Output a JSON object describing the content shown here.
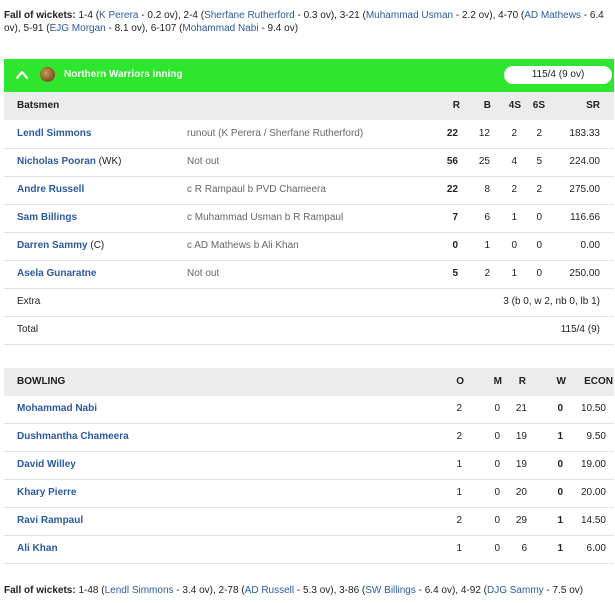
{
  "fall_top": {
    "label": "Fall of wickets:",
    "items": [
      {
        "score": "1-4",
        "player": "K Perera",
        "over": " - 0.2 ov), "
      },
      {
        "score": "2-4",
        "player": "Sherfane Rutherford",
        "over": " - 0.3 ov), "
      },
      {
        "score": "3-21",
        "player": "Muhammad Usman",
        "over": " - 2.2 ov), "
      },
      {
        "score": "4-70",
        "player": "AD Mathews",
        "over": " - 6.4 ov), "
      },
      {
        "score": "5-91",
        "player": "EJG Morgan",
        "over": " - 8.1 ov), "
      },
      {
        "score": "6-107",
        "player": "Mohammad Nabi",
        "over": " - 9.4 ov)"
      }
    ]
  },
  "inning": {
    "title": "Northern Warriors inning",
    "score": "115/4 (9 ov)"
  },
  "batting": {
    "headers": {
      "name": "Batsmen",
      "r": "R",
      "b": "B",
      "fours": "4S",
      "sixes": "6S",
      "sr": "SR"
    },
    "rows": [
      {
        "name": "Lendl Simmons",
        "suffix": "",
        "dismissal": "runout (K Perera / Sherfane Rutherford)",
        "r": "22",
        "b": "12",
        "fours": "2",
        "sixes": "2",
        "sr": "183.33"
      },
      {
        "name": "Nicholas Pooran",
        "suffix": " (WK)",
        "dismissal": "Not out",
        "r": "56",
        "b": "25",
        "fours": "4",
        "sixes": "5",
        "sr": "224.00"
      },
      {
        "name": "Andre Russell",
        "suffix": "",
        "dismissal": "c R Rampaul b PVD Chameera",
        "r": "22",
        "b": "8",
        "fours": "2",
        "sixes": "2",
        "sr": "275.00"
      },
      {
        "name": "Sam Billings",
        "suffix": "",
        "dismissal": "c Muhammad Usman b R Rampaul",
        "r": "7",
        "b": "6",
        "fours": "1",
        "sixes": "0",
        "sr": "116.66"
      },
      {
        "name": "Darren Sammy",
        "suffix": " (C)",
        "dismissal": "c AD Mathews b Ali Khan",
        "r": "0",
        "b": "1",
        "fours": "0",
        "sixes": "0",
        "sr": "0.00"
      },
      {
        "name": "Asela Gunaratne",
        "suffix": "",
        "dismissal": "Not out",
        "r": "5",
        "b": "2",
        "fours": "1",
        "sixes": "0",
        "sr": "250.00"
      }
    ],
    "extra_label": "Extra",
    "extra_value": "3 (b 0, w 2, nb 0, lb 1)",
    "total_label": "Total",
    "total_value": "115/4 (9)"
  },
  "bowling": {
    "headers": {
      "name": "BOWLING",
      "o": "O",
      "m": "M",
      "r": "R",
      "w": "W",
      "econ": "ECON"
    },
    "rows": [
      {
        "name": "Mohammad Nabi",
        "o": "2",
        "m": "0",
        "r": "21",
        "w": "0",
        "econ": "10.50"
      },
      {
        "name": "Dushmantha Chameera",
        "o": "2",
        "m": "0",
        "r": "19",
        "w": "1",
        "econ": "9.50"
      },
      {
        "name": "David Willey",
        "o": "1",
        "m": "0",
        "r": "19",
        "w": "0",
        "econ": "19.00"
      },
      {
        "name": "Khary Pierre",
        "o": "1",
        "m": "0",
        "r": "20",
        "w": "0",
        "econ": "20.00"
      },
      {
        "name": "Ravi Rampaul",
        "o": "2",
        "m": "0",
        "r": "29",
        "w": "1",
        "econ": "14.50"
      },
      {
        "name": "Ali Khan",
        "o": "1",
        "m": "0",
        "r": "6",
        "w": "1",
        "econ": "6.00"
      }
    ]
  },
  "fall_bottom": {
    "label": "Fall of wickets:",
    "items": [
      {
        "score": "1-48",
        "player": "Lendl Simmons",
        "over": " - 3.4 ov), "
      },
      {
        "score": "2-78",
        "player": "AD Russell",
        "over": " - 5.3 ov), "
      },
      {
        "score": "3-86",
        "player": "SW Billings",
        "over": " - 6.4 ov), "
      },
      {
        "score": "4-92",
        "player": "DJG Sammy",
        "over": " - 7.5 ov)"
      }
    ]
  },
  "colors": {
    "header_green": "#2ee62e",
    "link_blue": "#2b5aa0",
    "row_header_bg": "#ececec"
  }
}
